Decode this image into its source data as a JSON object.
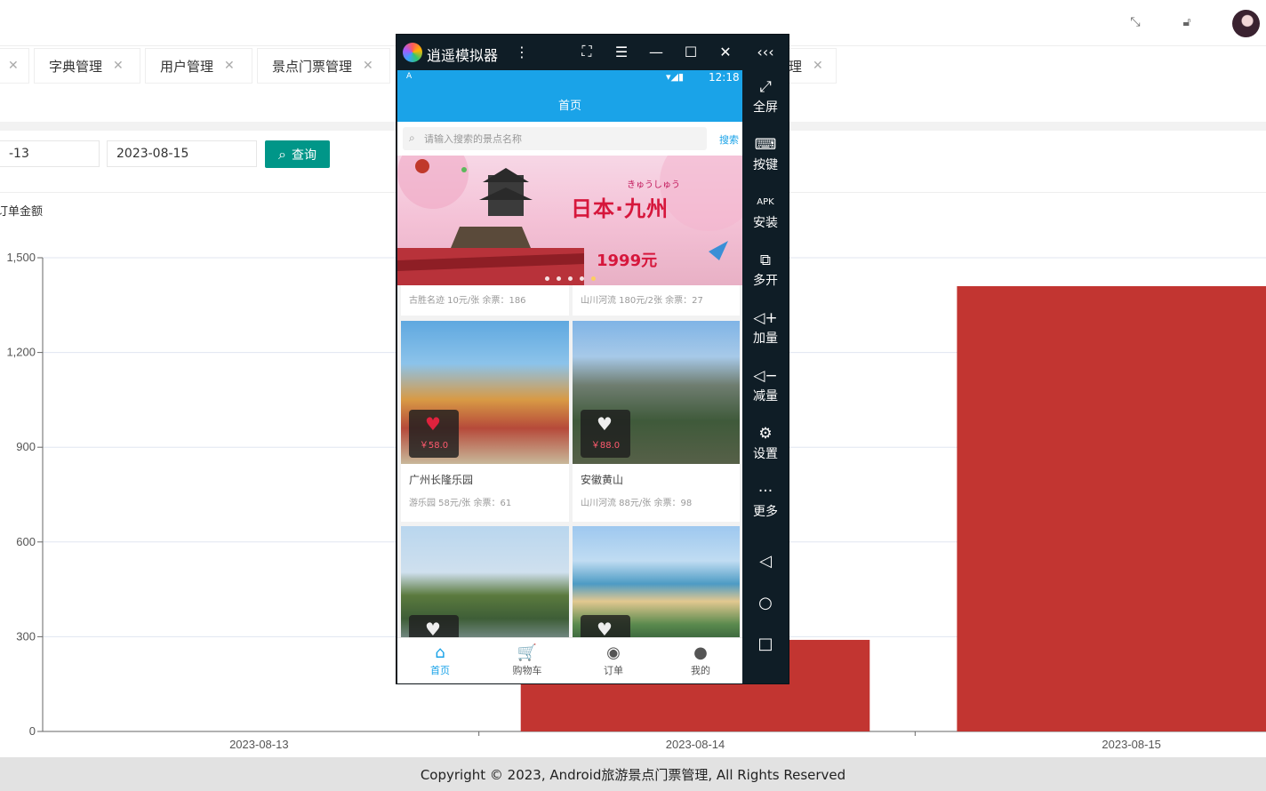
{
  "header": {
    "icons": [
      "fullscreen-icon",
      "lock-icon"
    ],
    "avatar_label": ""
  },
  "tabs": [
    {
      "label": "",
      "close": "✕"
    },
    {
      "label": "字典管理",
      "close": "✕"
    },
    {
      "label": "用户管理",
      "close": "✕"
    },
    {
      "label": "景点门票管理",
      "close": "✕"
    },
    {
      "label": "理",
      "close": "✕"
    }
  ],
  "filters": {
    "start_date": "-13",
    "end_date": "2023-08-15",
    "query_label": "查询"
  },
  "chart_data": {
    "type": "bar",
    "ylabel": "订单金额",
    "categories": [
      "2023-08-13",
      "2023-08-14",
      "2023-08-15"
    ],
    "values": [
      0,
      290,
      1410
    ],
    "ylim": [
      0,
      1500
    ],
    "yticks": [
      "0",
      "300",
      "600",
      "900",
      "1,200",
      "1,500"
    ],
    "color": "#c23531",
    "grid": true
  },
  "footer": {
    "text": "Copyright © 2023, Android旅游景点门票管理, All Rights Reserved"
  },
  "emulator": {
    "title": "逍遥模拟器",
    "controls": [
      "more-icon",
      "fit-screen-icon",
      "menu-icon",
      "minimize-icon",
      "maximize-icon",
      "close-icon",
      "collapse-icon"
    ],
    "control_glyphs": [
      "⋮",
      "⛶",
      "☰",
      "—",
      "☐",
      "✕",
      "‹‹‹"
    ],
    "phone": {
      "status_time": "12:18",
      "status_icons": "▾◢▮",
      "status_left": "A",
      "appbar_title": "首页",
      "search_placeholder": "请输入搜索的景点名称",
      "search_button": "搜索",
      "banner": {
        "title": "日本·九州",
        "kana": "きゅうしゅう",
        "price": "1999元"
      },
      "prev_row": [
        "古胜名迹  10元/张 余票：186",
        "山川河流  180元/2张 余票：27"
      ],
      "cards": [
        {
          "title": "广州长隆乐园",
          "sub": "游乐园  58元/张 余票：61",
          "price": "￥58.0",
          "liked": true
        },
        {
          "title": "安徽黄山",
          "sub": "山川河流  88元/张 余票：98",
          "price": "￥88.0",
          "liked": false
        },
        {
          "title": "",
          "sub": "",
          "price": "",
          "liked": false
        },
        {
          "title": "",
          "sub": "",
          "price": "",
          "liked": false
        }
      ],
      "nav": [
        {
          "label": "首页",
          "icon": "home-icon",
          "glyph": "⌂",
          "active": true
        },
        {
          "label": "购物车",
          "icon": "cart-icon",
          "glyph": "🛒",
          "active": false
        },
        {
          "label": "订单",
          "icon": "compass-icon",
          "glyph": "◉",
          "active": false
        },
        {
          "label": "我的",
          "icon": "person-icon",
          "glyph": "●",
          "active": false
        }
      ]
    },
    "sidebar": [
      {
        "label": "全屏",
        "icon": "fullscreen-icon",
        "glyph": "⤢"
      },
      {
        "label": "按键",
        "icon": "keyboard-icon",
        "glyph": "⌨"
      },
      {
        "label": "安装",
        "icon": "apk-icon",
        "glyph": "APK"
      },
      {
        "label": "多开",
        "icon": "multi-instance-icon",
        "glyph": "⧉"
      },
      {
        "label": "加量",
        "icon": "volume-up-icon",
        "glyph": "◁+"
      },
      {
        "label": "减量",
        "icon": "volume-down-icon",
        "glyph": "◁−"
      },
      {
        "label": "设置",
        "icon": "settings-icon",
        "glyph": "⚙"
      },
      {
        "label": "更多",
        "icon": "more-icon",
        "glyph": "···"
      }
    ],
    "android_nav": [
      {
        "icon": "back-icon",
        "glyph": "◁"
      },
      {
        "icon": "home-circle-icon",
        "glyph": "○"
      },
      {
        "icon": "recents-icon",
        "glyph": "□"
      }
    ]
  }
}
